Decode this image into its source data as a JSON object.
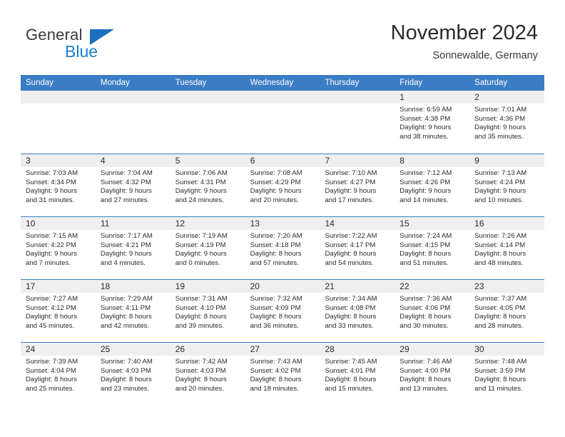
{
  "brand": {
    "name_top": "General",
    "name_bottom": "Blue",
    "color_dark": "#3b3b3b",
    "color_blue": "#1c7fd4"
  },
  "header": {
    "title": "November 2024",
    "subtitle": "Sonnewalde, Germany"
  },
  "theme": {
    "header_blue": "#3b7dc4",
    "day_band_gray": "#efefef",
    "text": "#2b2b2b"
  },
  "weekdays": [
    "Sunday",
    "Monday",
    "Tuesday",
    "Wednesday",
    "Thursday",
    "Friday",
    "Saturday"
  ],
  "weeks": [
    [
      {
        "day": "",
        "lines": []
      },
      {
        "day": "",
        "lines": []
      },
      {
        "day": "",
        "lines": []
      },
      {
        "day": "",
        "lines": []
      },
      {
        "day": "",
        "lines": []
      },
      {
        "day": "1",
        "lines": [
          "Sunrise: 6:59 AM",
          "Sunset: 4:38 PM",
          "Daylight: 9 hours",
          "and 38 minutes."
        ]
      },
      {
        "day": "2",
        "lines": [
          "Sunrise: 7:01 AM",
          "Sunset: 4:36 PM",
          "Daylight: 9 hours",
          "and 35 minutes."
        ]
      }
    ],
    [
      {
        "day": "3",
        "lines": [
          "Sunrise: 7:03 AM",
          "Sunset: 4:34 PM",
          "Daylight: 9 hours",
          "and 31 minutes."
        ]
      },
      {
        "day": "4",
        "lines": [
          "Sunrise: 7:04 AM",
          "Sunset: 4:32 PM",
          "Daylight: 9 hours",
          "and 27 minutes."
        ]
      },
      {
        "day": "5",
        "lines": [
          "Sunrise: 7:06 AM",
          "Sunset: 4:31 PM",
          "Daylight: 9 hours",
          "and 24 minutes."
        ]
      },
      {
        "day": "6",
        "lines": [
          "Sunrise: 7:08 AM",
          "Sunset: 4:29 PM",
          "Daylight: 9 hours",
          "and 20 minutes."
        ]
      },
      {
        "day": "7",
        "lines": [
          "Sunrise: 7:10 AM",
          "Sunset: 4:27 PM",
          "Daylight: 9 hours",
          "and 17 minutes."
        ]
      },
      {
        "day": "8",
        "lines": [
          "Sunrise: 7:12 AM",
          "Sunset: 4:26 PM",
          "Daylight: 9 hours",
          "and 14 minutes."
        ]
      },
      {
        "day": "9",
        "lines": [
          "Sunrise: 7:13 AM",
          "Sunset: 4:24 PM",
          "Daylight: 9 hours",
          "and 10 minutes."
        ]
      }
    ],
    [
      {
        "day": "10",
        "lines": [
          "Sunrise: 7:15 AM",
          "Sunset: 4:22 PM",
          "Daylight: 9 hours",
          "and 7 minutes."
        ]
      },
      {
        "day": "11",
        "lines": [
          "Sunrise: 7:17 AM",
          "Sunset: 4:21 PM",
          "Daylight: 9 hours",
          "and 4 minutes."
        ]
      },
      {
        "day": "12",
        "lines": [
          "Sunrise: 7:19 AM",
          "Sunset: 4:19 PM",
          "Daylight: 9 hours",
          "and 0 minutes."
        ]
      },
      {
        "day": "13",
        "lines": [
          "Sunrise: 7:20 AM",
          "Sunset: 4:18 PM",
          "Daylight: 8 hours",
          "and 57 minutes."
        ]
      },
      {
        "day": "14",
        "lines": [
          "Sunrise: 7:22 AM",
          "Sunset: 4:17 PM",
          "Daylight: 8 hours",
          "and 54 minutes."
        ]
      },
      {
        "day": "15",
        "lines": [
          "Sunrise: 7:24 AM",
          "Sunset: 4:15 PM",
          "Daylight: 8 hours",
          "and 51 minutes."
        ]
      },
      {
        "day": "16",
        "lines": [
          "Sunrise: 7:26 AM",
          "Sunset: 4:14 PM",
          "Daylight: 8 hours",
          "and 48 minutes."
        ]
      }
    ],
    [
      {
        "day": "17",
        "lines": [
          "Sunrise: 7:27 AM",
          "Sunset: 4:12 PM",
          "Daylight: 8 hours",
          "and 45 minutes."
        ]
      },
      {
        "day": "18",
        "lines": [
          "Sunrise: 7:29 AM",
          "Sunset: 4:11 PM",
          "Daylight: 8 hours",
          "and 42 minutes."
        ]
      },
      {
        "day": "19",
        "lines": [
          "Sunrise: 7:31 AM",
          "Sunset: 4:10 PM",
          "Daylight: 8 hours",
          "and 39 minutes."
        ]
      },
      {
        "day": "20",
        "lines": [
          "Sunrise: 7:32 AM",
          "Sunset: 4:09 PM",
          "Daylight: 8 hours",
          "and 36 minutes."
        ]
      },
      {
        "day": "21",
        "lines": [
          "Sunrise: 7:34 AM",
          "Sunset: 4:08 PM",
          "Daylight: 8 hours",
          "and 33 minutes."
        ]
      },
      {
        "day": "22",
        "lines": [
          "Sunrise: 7:36 AM",
          "Sunset: 4:06 PM",
          "Daylight: 8 hours",
          "and 30 minutes."
        ]
      },
      {
        "day": "23",
        "lines": [
          "Sunrise: 7:37 AM",
          "Sunset: 4:05 PM",
          "Daylight: 8 hours",
          "and 28 minutes."
        ]
      }
    ],
    [
      {
        "day": "24",
        "lines": [
          "Sunrise: 7:39 AM",
          "Sunset: 4:04 PM",
          "Daylight: 8 hours",
          "and 25 minutes."
        ]
      },
      {
        "day": "25",
        "lines": [
          "Sunrise: 7:40 AM",
          "Sunset: 4:03 PM",
          "Daylight: 8 hours",
          "and 23 minutes."
        ]
      },
      {
        "day": "26",
        "lines": [
          "Sunrise: 7:42 AM",
          "Sunset: 4:03 PM",
          "Daylight: 8 hours",
          "and 20 minutes."
        ]
      },
      {
        "day": "27",
        "lines": [
          "Sunrise: 7:43 AM",
          "Sunset: 4:02 PM",
          "Daylight: 8 hours",
          "and 18 minutes."
        ]
      },
      {
        "day": "28",
        "lines": [
          "Sunrise: 7:45 AM",
          "Sunset: 4:01 PM",
          "Daylight: 8 hours",
          "and 15 minutes."
        ]
      },
      {
        "day": "29",
        "lines": [
          "Sunrise: 7:46 AM",
          "Sunset: 4:00 PM",
          "Daylight: 8 hours",
          "and 13 minutes."
        ]
      },
      {
        "day": "30",
        "lines": [
          "Sunrise: 7:48 AM",
          "Sunset: 3:59 PM",
          "Daylight: 8 hours",
          "and 11 minutes."
        ]
      }
    ]
  ]
}
